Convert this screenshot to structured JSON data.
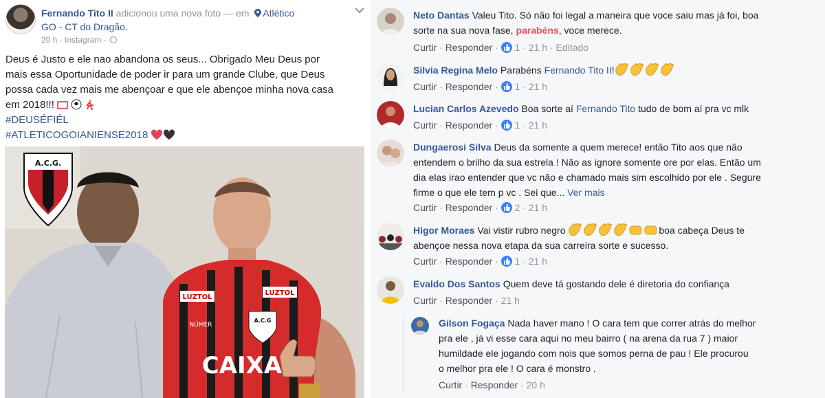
{
  "post": {
    "author": "Fernando Tito II",
    "action": "adicionou uma nova foto",
    "at_word": "— em",
    "location": "Atlético GO - CT do Dragão.",
    "location_line1": "Atlético",
    "location_line2": "GO - CT do Dragão.",
    "time": "20 h",
    "source": "· Instagram ·",
    "text_lines": [
      "Deus é Justo e ele nao abandona os seus... Obrigado Meu Deus por",
      "mais essa Oportunidade de poder ir para um grande Clube, que Deus",
      "possa cada vez mais me abençoar e que ele abençoe minha nova casa",
      "em 2018!!!"
    ],
    "hashtag1": "#DEUSÉFIÉL",
    "hashtag2": "#ATLETICOGOIANIENSE2018",
    "photo_texts": {
      "crest_left": "A.C.G.",
      "sponsor_left": "LUZTOL",
      "sponsor_right": "LUZTOL",
      "crest_shirt": "A.C.G",
      "number_label": "NÚMER",
      "main_sponsor": "CAIXA"
    }
  },
  "comments": [
    {
      "name": "Neto Dantas",
      "lines": [
        "Valeu Tito. Só não foi legal a maneira que voce saiu mas já foi, boa",
        "sorte na sua nova fase,"
      ],
      "highlight": "parabéns",
      "tail": ", voce merece.",
      "like_label": "Curtir",
      "reply_label": "Responder",
      "likes": "1",
      "time": "21 h",
      "edited": "Editado"
    },
    {
      "name": "Silvia Regina Melo",
      "text": "Parabéns",
      "mention": "Fernando Tito II",
      "tail": "!",
      "like_label": "Curtir",
      "reply_label": "Responder",
      "likes": "1",
      "time": "21 h"
    },
    {
      "name": "Lucian Carlos Azevedo",
      "text": "Boa sorte aí",
      "mention": "Fernando Tito",
      "tail": "tudo de bom aí pra vc mlk",
      "like_label": "Curtir",
      "reply_label": "Responder",
      "likes": "1",
      "time": "21 h"
    },
    {
      "name": "Dungaerosi Silva",
      "lines": [
        "Deus da somente a quem merece! então Tito aos que não",
        "entendem o brilho da sua estrela ! Não as ignore somente ore por elas. Então um",
        "dia elas irao entender que vc não e chamado mais sim escolhido por ele . Segure",
        "firme o que ele tem p vc . Sei que..."
      ],
      "see_more": "Ver mais",
      "like_label": "Curtir",
      "reply_label": "Responder",
      "likes": "2",
      "time": "21 h"
    },
    {
      "name": "Higor Moraes",
      "text": "Vai vistir rubro negro",
      "tail": "boa cabeça Deus te",
      "line2": "abençoe nessa nova etapa da sua carreira sorte e sucesso.",
      "like_label": "Curtir",
      "reply_label": "Responder",
      "likes": "1",
      "time": "21 h"
    },
    {
      "name": "Evaldo Dos Santos",
      "text": "Quem deve tá gostando dele é diretoria do confiança",
      "like_label": "Curtir",
      "reply_label": "Responder",
      "time": "21 h"
    }
  ],
  "reply": {
    "name": "Gilson Fogaça",
    "lines": [
      "Nada haver mano ! O cara tem que correr atrás do melhor",
      "pra ele , já vi esse cara aqui no meu bairro ( na arena da rua 7 ) maior",
      "humildade ele jogando com nois que somos perna de pau ! Ele procurou",
      "o melhor pra ele ! O cara é monstro ."
    ],
    "like_label": "Curtir",
    "reply_label": "Responder",
    "time": "20 h"
  },
  "colors": {
    "link": "#365899",
    "like_blue": "#4080ff",
    "highlight_red": "#e0525a"
  }
}
